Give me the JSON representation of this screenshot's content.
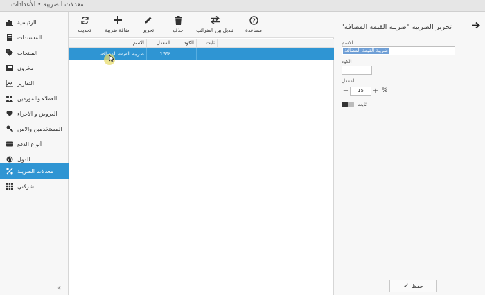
{
  "window": {
    "title": "معدلات الضريبة • الأعدادات"
  },
  "sidebar": {
    "items": [
      {
        "label": "الرئيسية",
        "icon": "bar-chart-icon"
      },
      {
        "label": "المستندات",
        "icon": "document-icon"
      },
      {
        "label": "المنتجات",
        "icon": "tag-icon"
      },
      {
        "label": "مخزون",
        "icon": "inbox-icon"
      },
      {
        "label": "التقارير",
        "icon": "chart-icon"
      },
      {
        "label": "العملاء والموردين",
        "icon": "users-icon"
      },
      {
        "label": "العروض و الاجراء",
        "icon": "heart-icon"
      },
      {
        "label": "المستخدمين والامن",
        "icon": "key-icon"
      },
      {
        "label": "أنواع الدفع",
        "icon": "card-icon"
      },
      {
        "label": "الدول",
        "icon": "globe-icon"
      },
      {
        "label": "معدلات الضريبة",
        "icon": "percent-icon",
        "active": true
      },
      {
        "label": "شركتي",
        "icon": "grid-icon"
      }
    ],
    "collapse_label": "«"
  },
  "toolbar": {
    "refresh": "تحديث",
    "add": "اضافة ضريبة",
    "edit": "تحرير",
    "delete": "حذف",
    "swap": "تبديل بين الضرائب",
    "help": "مساعدة"
  },
  "grid": {
    "columns": {
      "name": "الاسم",
      "rate": "المعدل",
      "code": "الكود",
      "fixed": "ثابت"
    },
    "rows": [
      {
        "name": "ضريبة القيمة المضافة",
        "rate": "15%",
        "code": "",
        "fixed": ""
      }
    ]
  },
  "editor": {
    "title": "تحرير الضريبة \"ضريبة القيمة المضافة\"",
    "name_label": "الاسم",
    "name_value": "ضريبة القيمة المضافة",
    "code_label": "الكود",
    "rate_label": "المعدل",
    "rate_value": "15",
    "rate_unit": "%",
    "minus": "−",
    "plus": "+",
    "fixed_label": "ثابت",
    "save_label": "حفظ"
  },
  "colors": {
    "accent": "#2f95d3",
    "selection": "#6f9fd6"
  }
}
